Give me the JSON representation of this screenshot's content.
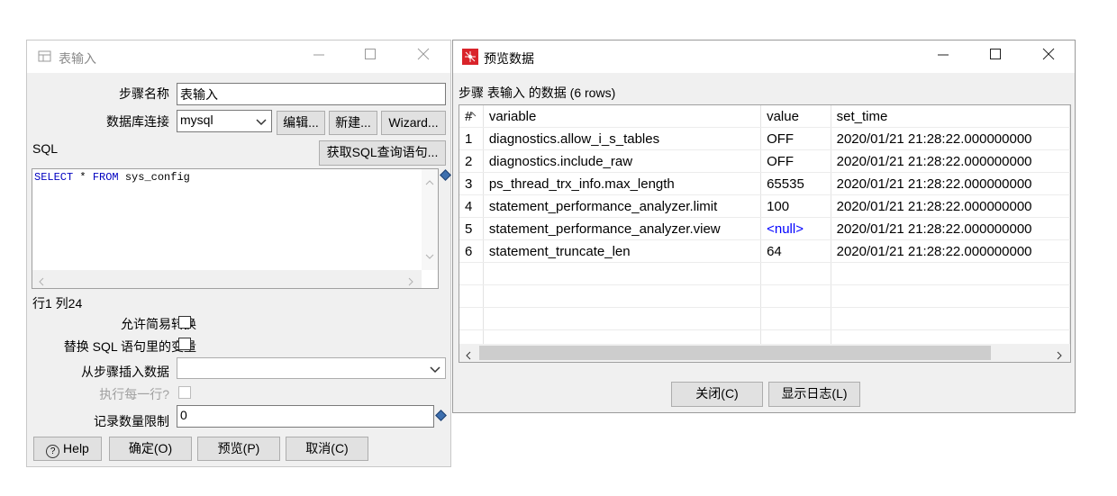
{
  "dialog": {
    "title": "表输入",
    "step_name_label": "步骤名称",
    "step_name_value": "表输入",
    "db_conn_label": "数据库连接",
    "db_conn_value": "mysql",
    "edit_button": "编辑...",
    "new_button": "新建...",
    "wizard_button": "Wizard...",
    "sql_label": "SQL",
    "get_sql_button": "获取SQL查询语句...",
    "sql_keyword_select": "SELECT",
    "sql_star": " * ",
    "sql_keyword_from": "FROM",
    "sql_rest": " sys_config",
    "cursor_position": "行1 列24",
    "lazy_conversion_label": "允许简易转换",
    "replace_vars_label": "替换 SQL 语句里的变量",
    "insert_from_step_label": "从步骤插入数据",
    "insert_from_step_value": "",
    "execute_each_row_label": "执行每一行?",
    "limit_label": "记录数量限制",
    "limit_value": "0",
    "help_button": "Help",
    "ok_button": "确定(O)",
    "preview_button": "预览(P)",
    "cancel_button": "取消(C)"
  },
  "preview": {
    "title": "预览数据",
    "subtitle": "步骤 表输入 的数据 (6 rows)",
    "columns": [
      "#",
      "variable",
      "value",
      "set_time"
    ],
    "rows": [
      [
        "1",
        "diagnostics.allow_i_s_tables",
        "OFF",
        "2020/01/21 21:28:22.000000000"
      ],
      [
        "2",
        "diagnostics.include_raw",
        "OFF",
        "2020/01/21 21:28:22.000000000"
      ],
      [
        "3",
        "ps_thread_trx_info.max_length",
        "65535",
        "2020/01/21 21:28:22.000000000"
      ],
      [
        "4",
        "statement_performance_analyzer.limit",
        "100",
        "2020/01/21 21:28:22.000000000"
      ],
      [
        "5",
        "statement_performance_analyzer.view",
        "<null>",
        "2020/01/21 21:28:22.000000000"
      ],
      [
        "6",
        "statement_truncate_len",
        "64",
        "2020/01/21 21:28:22.000000000"
      ]
    ],
    "close_button": "关闭(C)",
    "show_log_button": "显示日志(L)"
  },
  "colors": {
    "sql_keyword": "#0000c0",
    "null_value": "#0000ff",
    "accent_icon": "#d9232a"
  }
}
